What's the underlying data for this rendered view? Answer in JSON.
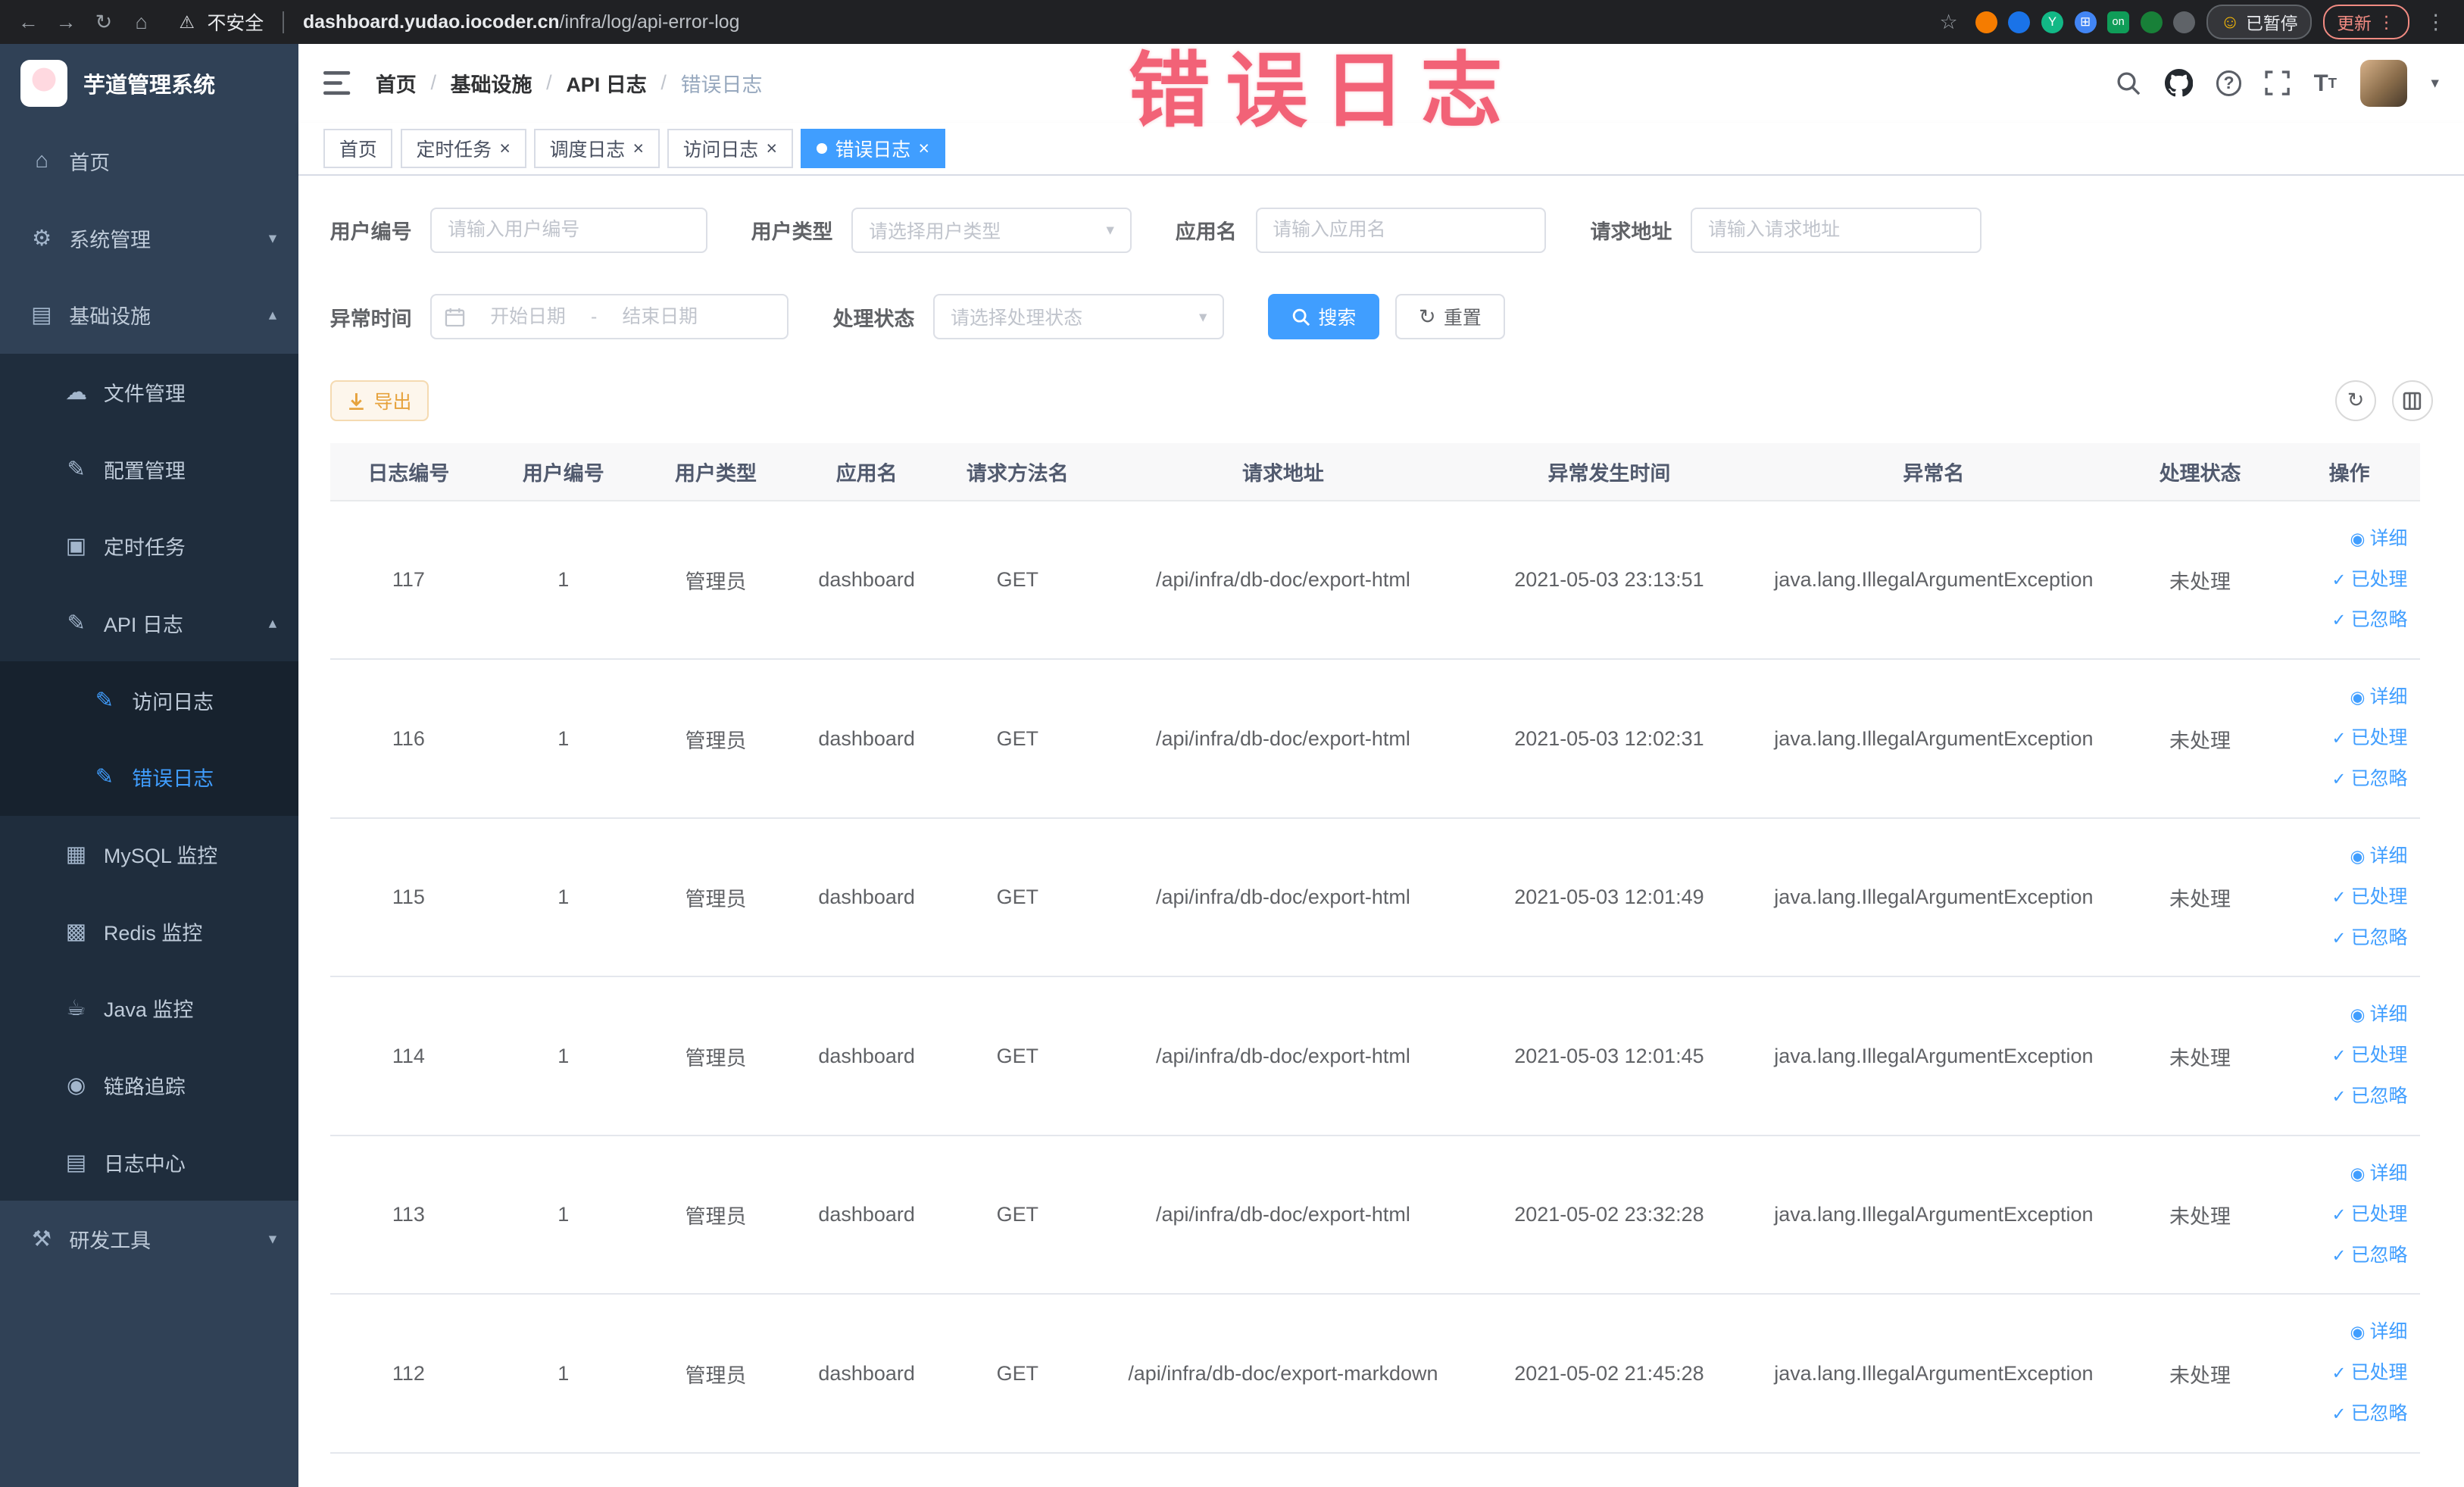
{
  "browser": {
    "security_label": "不安全",
    "url_domain": "dashboard.yudao.iocoder.cn",
    "url_path": "/infra/log/api-error-log",
    "paused_badge": "已暂停",
    "update_label": "更新"
  },
  "annotation": {
    "text": "错误日志"
  },
  "sidebar": {
    "logo_title": "芋道管理系统",
    "menu": {
      "home": "首页",
      "system": "系统管理",
      "infra": "基础设施",
      "file": "文件管理",
      "config": "配置管理",
      "job": "定时任务",
      "api_log": "API 日志",
      "access_log": "访问日志",
      "error_log": "错误日志",
      "mysql": "MySQL 监控",
      "redis": "Redis 监控",
      "java": "Java 监控",
      "trace": "链路追踪",
      "log_center": "日志中心",
      "dev_tools": "研发工具"
    }
  },
  "navbar": {
    "breadcrumb": [
      "首页",
      "基础设施",
      "API 日志",
      "错误日志"
    ]
  },
  "tabs": [
    {
      "label": "首页"
    },
    {
      "label": "定时任务"
    },
    {
      "label": "调度日志"
    },
    {
      "label": "访问日志"
    },
    {
      "label": "错误日志"
    }
  ],
  "filters": {
    "user_id_label": "用户编号",
    "user_id_placeholder": "请输入用户编号",
    "user_type_label": "用户类型",
    "user_type_placeholder": "请选择用户类型",
    "app_name_label": "应用名",
    "app_name_placeholder": "请输入应用名",
    "request_url_label": "请求地址",
    "request_url_placeholder": "请输入请求地址",
    "exception_time_label": "异常时间",
    "start_date_placeholder": "开始日期",
    "range_separator": "-",
    "end_date_placeholder": "结束日期",
    "process_status_label": "处理状态",
    "process_status_placeholder": "请选择处理状态",
    "search_label": "搜索",
    "reset_label": "重置"
  },
  "toolbar": {
    "export_label": "导出"
  },
  "table": {
    "columns": [
      "日志编号",
      "用户编号",
      "用户类型",
      "应用名",
      "请求方法名",
      "请求地址",
      "异常发生时间",
      "异常名",
      "处理状态",
      "操作"
    ],
    "actions": {
      "detail": "详细",
      "processed": "已处理",
      "ignored": "已忽略"
    },
    "rows": [
      {
        "id": "117",
        "user_id": "1",
        "user_type": "管理员",
        "app": "dashboard",
        "method": "GET",
        "url": "/api/infra/db-doc/export-html",
        "time": "2021-05-03 23:13:51",
        "exception": "java.lang.IllegalArgumentException",
        "status": "未处理"
      },
      {
        "id": "116",
        "user_id": "1",
        "user_type": "管理员",
        "app": "dashboard",
        "method": "GET",
        "url": "/api/infra/db-doc/export-html",
        "time": "2021-05-03 12:02:31",
        "exception": "java.lang.IllegalArgumentException",
        "status": "未处理"
      },
      {
        "id": "115",
        "user_id": "1",
        "user_type": "管理员",
        "app": "dashboard",
        "method": "GET",
        "url": "/api/infra/db-doc/export-html",
        "time": "2021-05-03 12:01:49",
        "exception": "java.lang.IllegalArgumentException",
        "status": "未处理"
      },
      {
        "id": "114",
        "user_id": "1",
        "user_type": "管理员",
        "app": "dashboard",
        "method": "GET",
        "url": "/api/infra/db-doc/export-html",
        "time": "2021-05-03 12:01:45",
        "exception": "java.lang.IllegalArgumentException",
        "status": "未处理"
      },
      {
        "id": "113",
        "user_id": "1",
        "user_type": "管理员",
        "app": "dashboard",
        "method": "GET",
        "url": "/api/infra/db-doc/export-html",
        "time": "2021-05-02 23:32:28",
        "exception": "java.lang.IllegalArgumentException",
        "status": "未处理"
      },
      {
        "id": "112",
        "user_id": "1",
        "user_type": "管理员",
        "app": "dashboard",
        "method": "GET",
        "url": "/api/infra/db-doc/export-markdown",
        "time": "2021-05-02 21:45:28",
        "exception": "java.lang.IllegalArgumentException",
        "status": "未处理"
      }
    ]
  },
  "accent_colors": {
    "primary": "#409eff",
    "warning": "#e6a23c",
    "annotation": "#f1556c",
    "sidebar_bg": "#304156",
    "submenu_bg": "#1f2d3d"
  }
}
